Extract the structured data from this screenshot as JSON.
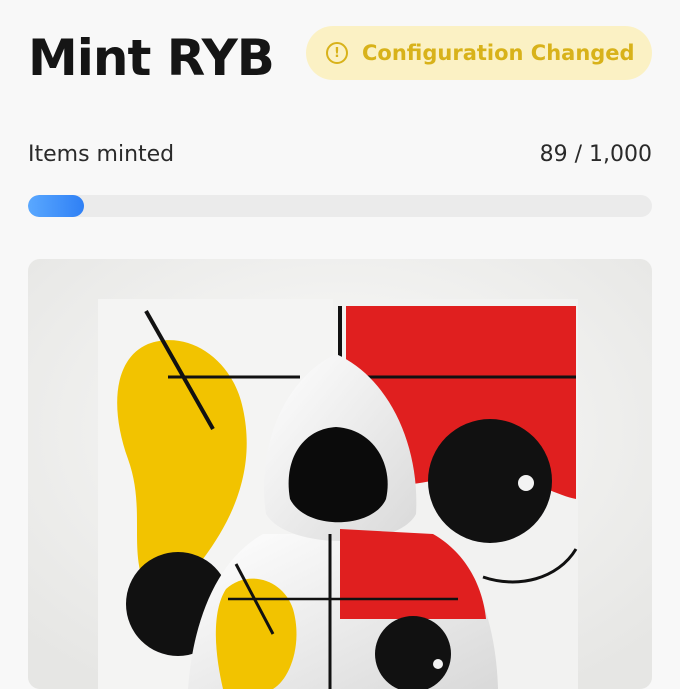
{
  "header": {
    "title": "Mint RYB",
    "status_badge": {
      "label": "Configuration Changed",
      "icon": "warning-circle-icon",
      "icon_glyph": "!",
      "color": "#d8b21a",
      "background": "#fbf1c4"
    }
  },
  "progress": {
    "label": "Items minted",
    "count_text": "89 / 1,000",
    "minted": 89,
    "total": 1000,
    "fill_color": "#2f80f5"
  },
  "artwork": {
    "subject": "hooded figure in white hoodie before abstract red-yellow-blue painting",
    "palette": {
      "red": "#e01f1f",
      "yellow": "#f2c300",
      "black": "#111111",
      "white": "#f3f3f3"
    }
  }
}
